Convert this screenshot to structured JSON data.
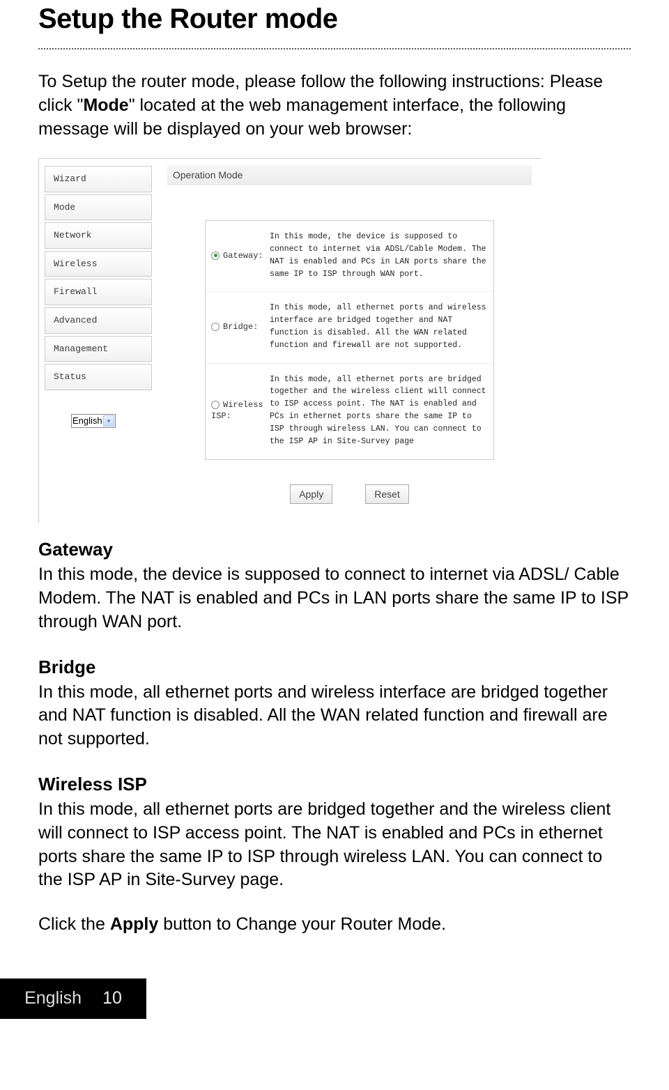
{
  "page": {
    "title": "Setup the Router mode",
    "intro_pre": "To Setup the router mode, please follow the following instructions: Please click \"",
    "intro_bold": "Mode",
    "intro_post": "\" located at the web management interface, the following message will be displayed on your web browser:",
    "footer_click_pre": "Click the ",
    "footer_click_bold": "Apply",
    "footer_click_post": " button to Change your Router Mode.",
    "footer": {
      "language": "English",
      "page_number": "10"
    }
  },
  "screenshot": {
    "menu": [
      "Wizard",
      "Mode",
      "Network",
      "Wireless",
      "Firewall",
      "Advanced",
      "Management",
      "Status"
    ],
    "language_dropdown": "English",
    "panel_title": "Operation Mode",
    "modes": {
      "gateway": {
        "label": "Gateway:",
        "desc": "In this mode, the device is supposed to connect to internet via ADSL/Cable Modem. The NAT is enabled and PCs in LAN ports share the same IP to ISP through WAN port."
      },
      "bridge": {
        "label": "Bridge:",
        "desc": "In this mode, all ethernet ports and wireless interface are bridged together and NAT function is disabled. All the WAN related function and firewall are not supported."
      },
      "wireless_isp": {
        "label_top": "Wireless",
        "label_bottom": "ISP:",
        "desc": "In this mode, all ethernet ports are bridged together and the wireless client will connect to ISP access point. The NAT is enabled and PCs in ethernet ports share the same IP to ISP through wireless LAN. You can connect to the ISP AP in Site-Survey page"
      }
    },
    "buttons": {
      "apply": "Apply",
      "reset": "Reset"
    }
  },
  "sections": {
    "gateway": {
      "title": "Gateway",
      "body": "In this mode, the device is supposed to connect to internet via ADSL/ Cable Modem. The NAT is enabled and PCs in LAN ports share the same IP to ISP through WAN port."
    },
    "bridge": {
      "title": "Bridge",
      "body": "In this mode, all ethernet ports and wireless interface are bridged together and NAT function is disabled. All the WAN related function and firewall are not supported."
    },
    "wireless_isp": {
      "title": "Wireless ISP",
      "body": "In this mode, all ethernet ports are bridged together and the wireless client will connect to ISP access point. The NAT is enabled and PCs in ethernet ports share the same IP to ISP through wireless LAN. You can connect to the ISP AP in Site-Survey page."
    }
  }
}
